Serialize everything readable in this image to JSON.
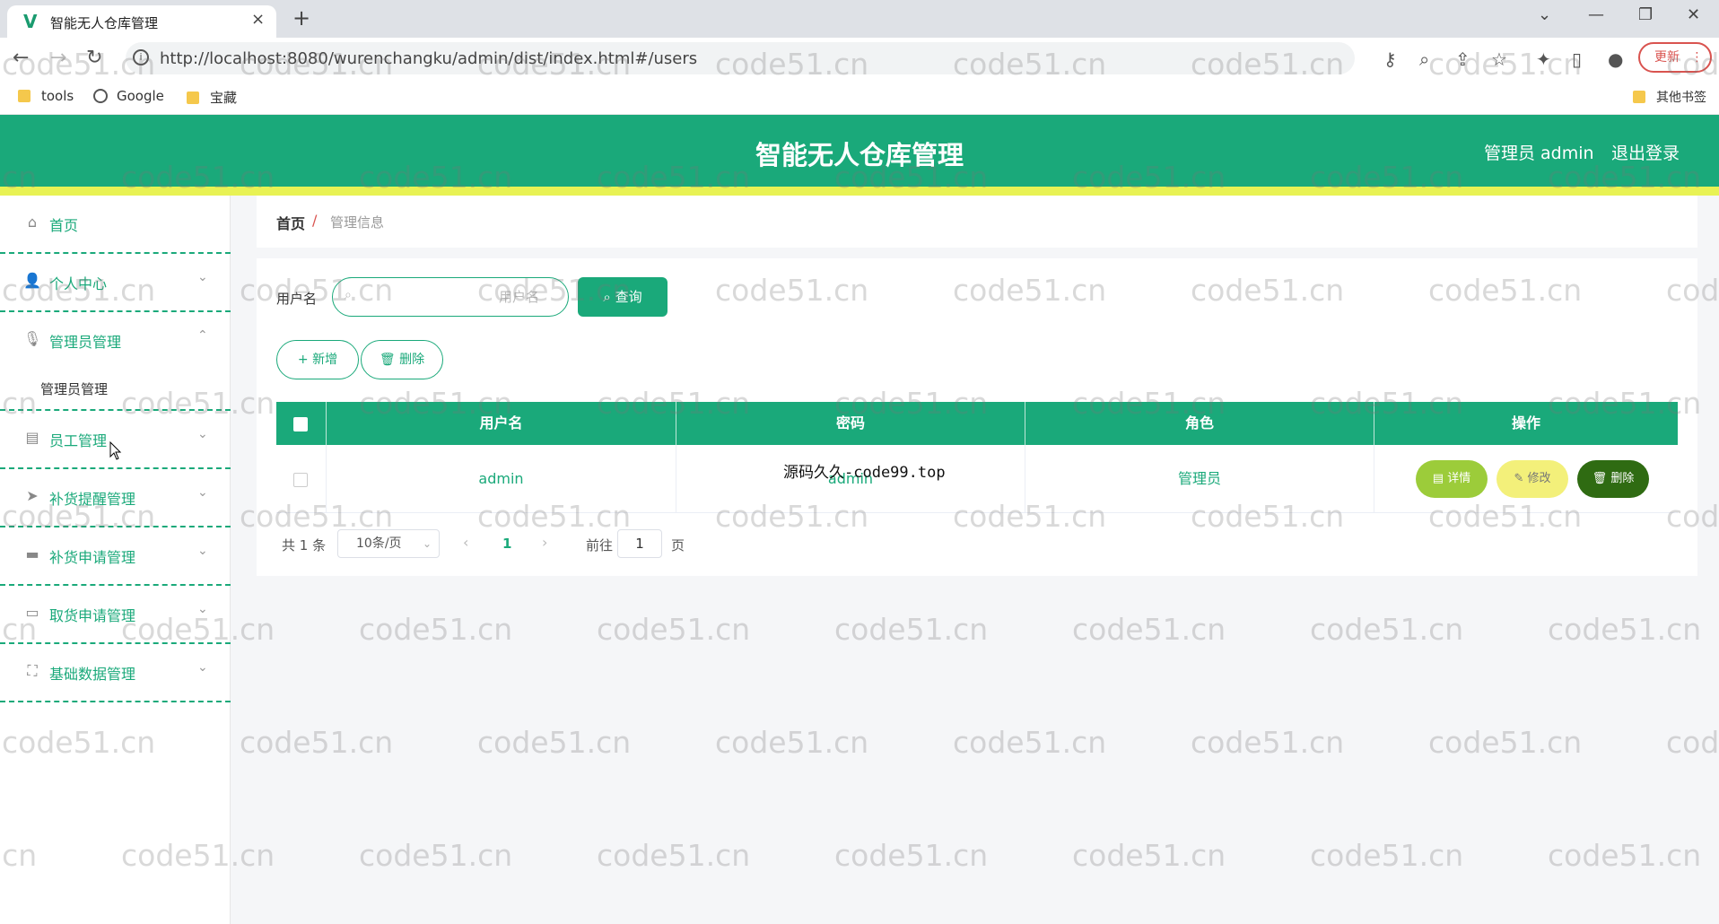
{
  "browser": {
    "tab_title": "智能无人仓库管理",
    "tab_close": "×",
    "new_tab": "+",
    "url": "http://localhost:8080/wurenchangku/admin/dist/index.html#/users",
    "update_label": "更新",
    "bookmarks": [
      "tools",
      "Google",
      "宝藏"
    ],
    "other_bookmarks": "其他书签"
  },
  "header": {
    "title": "智能无人仓库管理",
    "user": "管理员 admin",
    "logout": "退出登录"
  },
  "sidebar": {
    "items": [
      {
        "label": "首页",
        "icon": "home-icon"
      },
      {
        "label": "个人中心",
        "icon": "user-icon"
      },
      {
        "label": "管理员管理",
        "icon": "microphone-icon"
      },
      {
        "label": "员工管理",
        "icon": "chat-icon"
      },
      {
        "label": "补货提醒管理",
        "icon": "send-icon"
      },
      {
        "label": "补货申请管理",
        "icon": "briefcase-icon"
      },
      {
        "label": "取货申请管理",
        "icon": "message-icon"
      },
      {
        "label": "基础数据管理",
        "icon": "fullscreen-icon"
      }
    ],
    "submenu": [
      "管理员管理"
    ]
  },
  "breadcrumb": {
    "home": "首页",
    "separator": "/",
    "current": "管理信息"
  },
  "search": {
    "label": "用户名",
    "placeholder": "用户名",
    "button": "查询"
  },
  "actions": {
    "add": "新增",
    "delete": "删除"
  },
  "table": {
    "columns": [
      "用户名",
      "密码",
      "角色",
      "操作"
    ],
    "rows": [
      {
        "username": "admin",
        "password": "admin",
        "role": "管理员"
      }
    ],
    "row_actions": {
      "detail": "详情",
      "edit": "修改",
      "delete": "删除"
    }
  },
  "pagination": {
    "total": "共 1 条",
    "page_size": "10条/页",
    "current_page": "1",
    "goto_label": "前往",
    "goto_value": "1",
    "page_unit": "页"
  },
  "overlay_text": "源码久久-code99.top",
  "watermark": "code51.cn",
  "colors": {
    "primary": "#1aa97a",
    "header_strip": "#e8f254",
    "detail_btn": "#9ccc3a",
    "edit_btn": "#f3f07a",
    "delete_btn": "#2f6b12"
  }
}
